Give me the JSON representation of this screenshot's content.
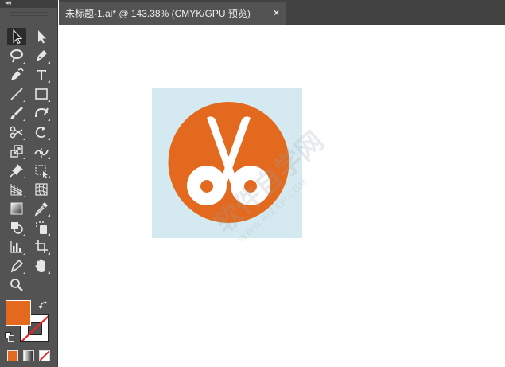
{
  "document": {
    "tab_title": "未标题-1.ai* @ 143.38% (CMYK/GPU 预览)",
    "close_label": "×"
  },
  "toolbar": {
    "collapse_label": "◂◂",
    "tools": [
      {
        "name": "selection-tool",
        "icon": "arrow-black"
      },
      {
        "name": "direct-selection-tool",
        "icon": "arrow-white"
      },
      {
        "name": "lasso-tool",
        "icon": "lasso"
      },
      {
        "name": "pen-tool",
        "icon": "pen"
      },
      {
        "name": "curvature-tool",
        "icon": "curvature"
      },
      {
        "name": "type-tool",
        "icon": "T"
      },
      {
        "name": "line-tool",
        "icon": "line"
      },
      {
        "name": "rectangle-tool",
        "icon": "rect"
      },
      {
        "name": "paintbrush-tool",
        "icon": "brush"
      },
      {
        "name": "blob-brush-tool",
        "icon": "blob"
      },
      {
        "name": "scissors-tool",
        "icon": "scissors"
      },
      {
        "name": "rotate-tool",
        "icon": "rotate"
      },
      {
        "name": "scale-tool",
        "icon": "scale"
      },
      {
        "name": "warp-tool",
        "icon": "warp"
      },
      {
        "name": "puppet-warp-tool",
        "icon": "pin"
      },
      {
        "name": "free-transform-tool",
        "icon": "free-transform"
      },
      {
        "name": "perspective-grid-tool",
        "icon": "grid"
      },
      {
        "name": "mesh-tool",
        "icon": "mesh"
      },
      {
        "name": "gradient-tool",
        "icon": "gradient"
      },
      {
        "name": "eyedropper-tool",
        "icon": "eyedropper"
      },
      {
        "name": "blend-tool",
        "icon": "blend"
      },
      {
        "name": "symbol-sprayer-tool",
        "icon": "spray"
      },
      {
        "name": "column-graph-tool",
        "icon": "graph"
      },
      {
        "name": "artboard-tool",
        "icon": "artboard"
      },
      {
        "name": "slice-tool",
        "icon": "slice"
      },
      {
        "name": "hand-tool",
        "icon": "hand"
      },
      {
        "name": "zoom-tool",
        "icon": "zoom"
      }
    ],
    "fill_color": "#e2691d",
    "stroke_color": "none"
  },
  "artwork": {
    "background_color": "#d4eaf0",
    "circle_color": "#e2691d",
    "scissors_color": "#ffffff",
    "icon": "scissors-icon"
  },
  "watermark": {
    "text": "软件自学网",
    "url": "WWW.RJZXW.COM"
  }
}
